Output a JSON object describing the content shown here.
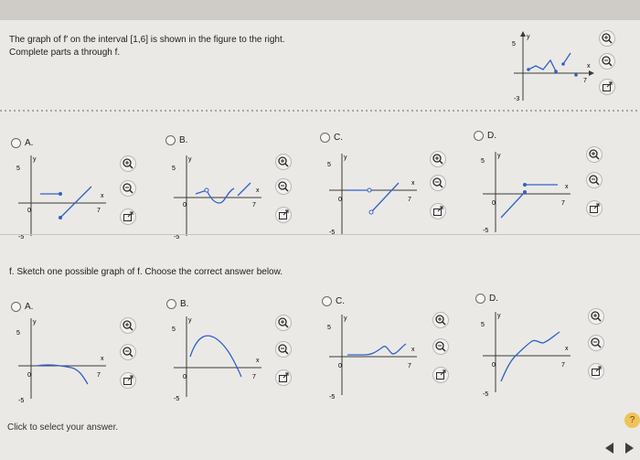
{
  "question": {
    "line1": "The graph of f′ on the interval [1,6] is shown in the figure to the right.",
    "line2": "Complete parts a through f."
  },
  "axis": {
    "top": "5",
    "bottom": "-5",
    "bottom_main": "-3",
    "x": "x",
    "y": "y",
    "xmax": "7",
    "origin": "0"
  },
  "options_top": [
    "A.",
    "B.",
    "C.",
    "D."
  ],
  "part_f": "f. Sketch one possible graph of f. Choose the correct answer below.",
  "options_f": [
    "A.",
    "B.",
    "C.",
    "D."
  ],
  "footer": "Click to select your answer.",
  "help_label": "?",
  "colors": {
    "graph": "#2f62c9",
    "axis": "#3a3a3a",
    "tool_icon": "#2a2a2a"
  }
}
